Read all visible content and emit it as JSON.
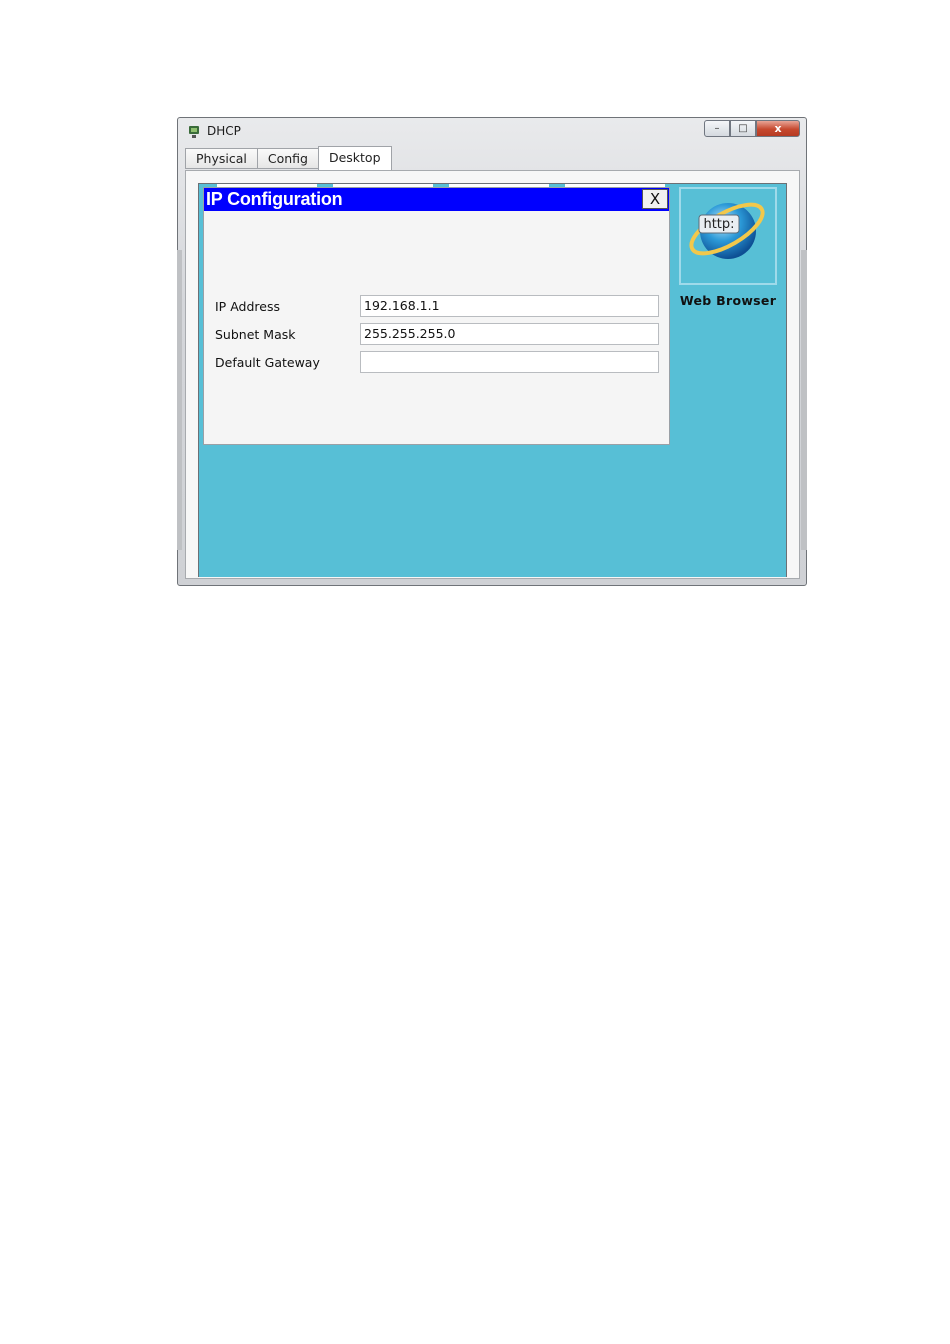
{
  "window": {
    "title": "DHCP",
    "controls": {
      "minimize": "–",
      "maximize": "□",
      "close": "x"
    }
  },
  "tabs": [
    {
      "label": "Physical",
      "active": false
    },
    {
      "label": "Config",
      "active": false
    },
    {
      "label": "Desktop",
      "active": true
    }
  ],
  "dialog": {
    "title": "IP Configuration",
    "close_label": "X",
    "fields": [
      {
        "label": "IP Address",
        "value": "192.168.1.1"
      },
      {
        "label": "Subnet Mask",
        "value": "255.255.255.0"
      },
      {
        "label": "Default Gateway",
        "value": ""
      }
    ]
  },
  "desktop_apps": [
    {
      "label": "Web Browser",
      "icon": "web-browser-icon",
      "icon_text": "http:"
    }
  ],
  "colors": {
    "desktop_bg": "#57bfd6",
    "dialog_title_bg": "#0000ff",
    "close_button": "#c6492f"
  }
}
